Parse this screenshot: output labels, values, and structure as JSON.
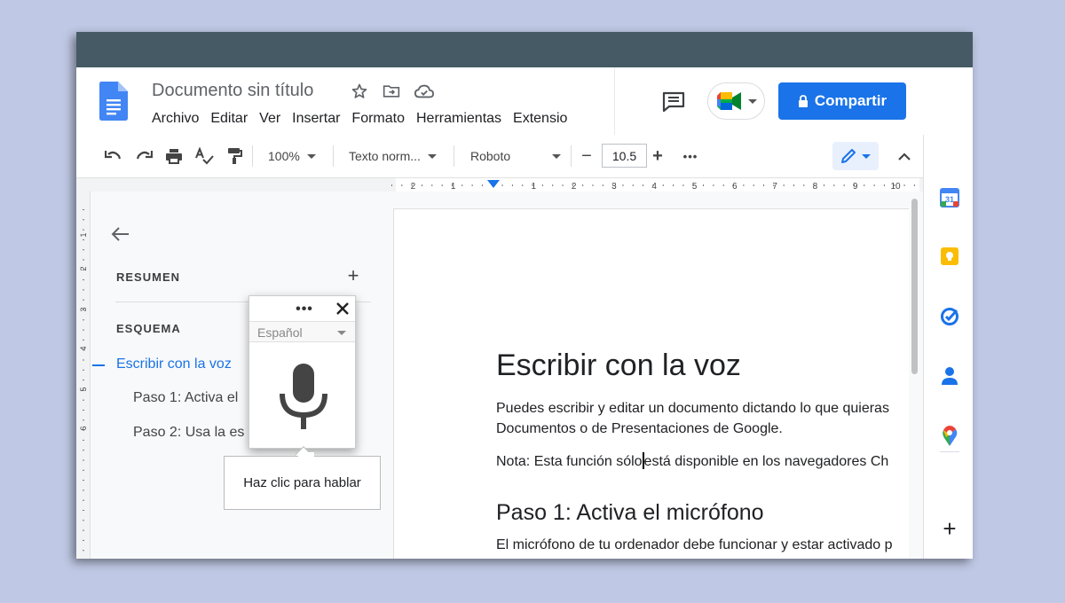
{
  "header": {
    "doc_title": "Documento sin título",
    "menu": [
      "Archivo",
      "Editar",
      "Ver",
      "Insertar",
      "Formato",
      "Herramientas",
      "Extensio"
    ],
    "share_label": "Compartir"
  },
  "toolbar": {
    "zoom": "100%",
    "style": "Texto norm...",
    "font": "Roboto",
    "font_size": "10.5",
    "minus": "−",
    "plus": "+",
    "more": "•••"
  },
  "ruler": {
    "marks": [
      "2",
      "1",
      "1",
      "2",
      "3",
      "4",
      "5",
      "6",
      "7",
      "8",
      "9",
      "10"
    ]
  },
  "ruler_v": {
    "marks": [
      "2",
      "1",
      "1",
      "2",
      "3",
      "4",
      "5",
      "6"
    ]
  },
  "outline": {
    "summary_label": "RESUMEN",
    "add": "+",
    "outline_label": "ESQUEMA",
    "items": [
      "Escribir con la voz",
      "Paso 1: Activa el",
      "Paso 2: Usa la es"
    ]
  },
  "document": {
    "heading": "Escribir con la voz",
    "p1_line1": "Puedes escribir y editar un documento dictando lo que quieras",
    "p1_line2": "Documentos o de Presentaciones de Google.",
    "note_before": "Nota: Esta función sólo",
    "note_after": "está disponible en los navegadores Ch",
    "heading2": "Paso 1: Activa el micrófono",
    "p2": "El micrófono de tu ordenador debe funcionar y estar activado p"
  },
  "voice": {
    "more": "•••",
    "language": "Español",
    "tooltip": "Haz clic para hablar"
  },
  "side_panel": {
    "calendar_day": "31",
    "add": "+"
  },
  "colors": {
    "accent": "#1a73e8",
    "titlebar": "#455a64",
    "background": "#bfc8e4"
  }
}
